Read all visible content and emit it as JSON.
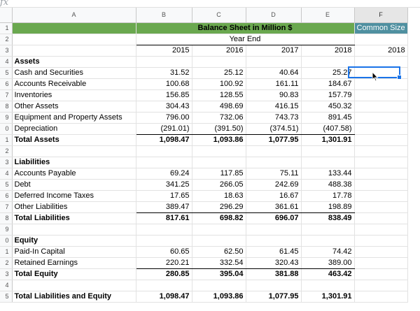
{
  "formula_bar": {
    "icon": "fx"
  },
  "columns": [
    "A",
    "B",
    "C",
    "D",
    "E",
    "F"
  ],
  "rows": [
    {
      "rh": "1",
      "type": "title"
    },
    {
      "rh": "2",
      "type": "yearend"
    },
    {
      "rh": "3",
      "type": "years"
    },
    {
      "rh": "4",
      "label": "Assets",
      "bold": true,
      "v": [
        "",
        "",
        "",
        ""
      ]
    },
    {
      "rh": "5",
      "label": "Cash and Securities",
      "v": [
        "31.52",
        "25.12",
        "40.64",
        "25.27"
      ]
    },
    {
      "rh": "6",
      "label": "Accounts Receivable",
      "v": [
        "100.68",
        "100.92",
        "161.11",
        "184.67"
      ]
    },
    {
      "rh": "7",
      "label": "Inventories",
      "v": [
        "156.85",
        "128.55",
        "90.83",
        "157.79"
      ]
    },
    {
      "rh": "8",
      "label": "Other Assets",
      "v": [
        "304.43",
        "498.69",
        "416.15",
        "450.32"
      ]
    },
    {
      "rh": "9",
      "label": "Equipment and Property Assets",
      "v": [
        "796.00",
        "732.06",
        "743.73",
        "891.45"
      ]
    },
    {
      "rh": "0",
      "label": "Depreciation",
      "v": [
        "(291.01)",
        "(391.50)",
        "(374.51)",
        "(407.58)"
      ],
      "ul": true
    },
    {
      "rh": "1",
      "label": "Total Assets",
      "bold": true,
      "v": [
        "1,098.47",
        "1,093.86",
        "1,077.95",
        "1,301.91"
      ]
    },
    {
      "rh": "2",
      "label": "",
      "v": [
        "",
        "",
        "",
        ""
      ]
    },
    {
      "rh": "3",
      "label": "Liabilities",
      "bold": true,
      "v": [
        "",
        "",
        "",
        ""
      ]
    },
    {
      "rh": "4",
      "label": "Accounts Payable",
      "v": [
        "69.24",
        "117.85",
        "75.11",
        "133.44"
      ]
    },
    {
      "rh": "5",
      "label": "Debt",
      "v": [
        "341.25",
        "266.05",
        "242.69",
        "488.38"
      ]
    },
    {
      "rh": "6",
      "label": "Deferred Income Taxes",
      "v": [
        "17.65",
        "18.63",
        "16.67",
        "17.78"
      ]
    },
    {
      "rh": "7",
      "label": "Other Liabilities",
      "v": [
        "389.47",
        "296.29",
        "361.61",
        "198.89"
      ],
      "ul": true
    },
    {
      "rh": "8",
      "label": "Total Liabilities",
      "bold": true,
      "v": [
        "817.61",
        "698.82",
        "696.07",
        "838.49"
      ]
    },
    {
      "rh": "9",
      "label": "",
      "v": [
        "",
        "",
        "",
        ""
      ]
    },
    {
      "rh": "0",
      "label": "Equity",
      "bold": true,
      "v": [
        "",
        "",
        "",
        ""
      ]
    },
    {
      "rh": "1",
      "label": "Paid-In Capital",
      "v": [
        "60.65",
        "62.50",
        "61.45",
        "74.42"
      ]
    },
    {
      "rh": "2",
      "label": "Retained Earnings",
      "v": [
        "220.21",
        "332.54",
        "320.43",
        "389.00"
      ],
      "ul": true
    },
    {
      "rh": "3",
      "label": "Total Equity",
      "bold": true,
      "v": [
        "280.85",
        "395.04",
        "381.88",
        "463.42"
      ]
    },
    {
      "rh": "4",
      "label": "",
      "v": [
        "",
        "",
        "",
        ""
      ]
    },
    {
      "rh": "5",
      "label": "Total Liabilities and Equity",
      "bold": true,
      "v": [
        "1,098.47",
        "1,093.86",
        "1,077.95",
        "1,301.91"
      ]
    }
  ],
  "sheet": {
    "title": "Balance Sheet in Million $",
    "common_size": "Common Size",
    "year_end": "Year End",
    "years": [
      "2015",
      "2016",
      "2017",
      "2018"
    ],
    "common_year": "2018"
  },
  "colors": {
    "title_bg": "#6aa84f",
    "common_bg": "#4f90a0",
    "selection": "#1a73e8"
  }
}
